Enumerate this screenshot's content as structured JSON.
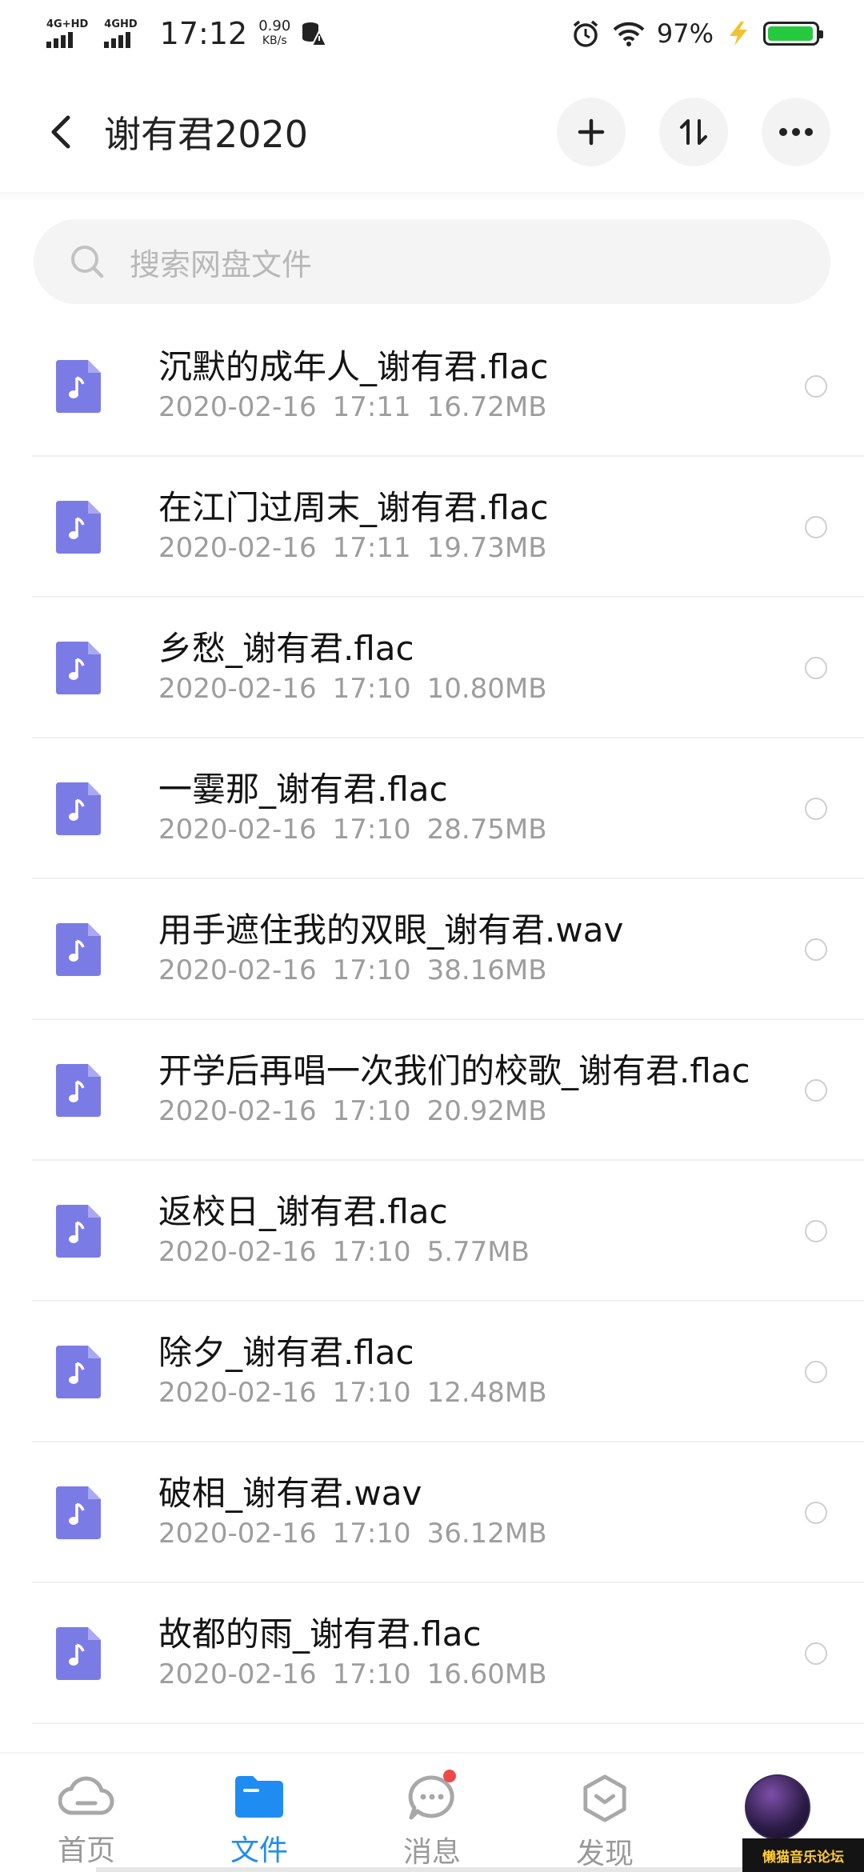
{
  "status_bar": {
    "network1": "4G+HD",
    "network2": "4GHD",
    "time": "17:12",
    "speed_value": "0.90",
    "speed_unit": "KB/s",
    "battery_percent": "97%",
    "battery_level": 0.97,
    "battery_color": "#27c93f"
  },
  "header": {
    "title": "谢有君2020",
    "icons": [
      "back-icon",
      "add-icon",
      "sort-icon",
      "more-icon"
    ]
  },
  "search": {
    "placeholder": "搜索网盘文件"
  },
  "files": [
    {
      "name": "沉默的成年人_谢有君.flac",
      "date": "2020-02-16",
      "time": "17:11",
      "size": "16.72MB"
    },
    {
      "name": "在江门过周末_谢有君.flac",
      "date": "2020-02-16",
      "time": "17:11",
      "size": "19.73MB"
    },
    {
      "name": "乡愁_谢有君.flac",
      "date": "2020-02-16",
      "time": "17:10",
      "size": "10.80MB"
    },
    {
      "name": "一霎那_谢有君.flac",
      "date": "2020-02-16",
      "time": "17:10",
      "size": "28.75MB"
    },
    {
      "name": "用手遮住我的双眼_谢有君.wav",
      "date": "2020-02-16",
      "time": "17:10",
      "size": "38.16MB"
    },
    {
      "name": "开学后再唱一次我们的校歌_谢有君.flac",
      "date": "2020-02-16",
      "time": "17:10",
      "size": "20.92MB"
    },
    {
      "name": "返校日_谢有君.flac",
      "date": "2020-02-16",
      "time": "17:10",
      "size": "5.77MB"
    },
    {
      "name": "除夕_谢有君.flac",
      "date": "2020-02-16",
      "time": "17:10",
      "size": "12.48MB"
    },
    {
      "name": "破相_谢有君.wav",
      "date": "2020-02-16",
      "time": "17:10",
      "size": "36.12MB"
    },
    {
      "name": "故都的雨_谢有君.flac",
      "date": "2020-02-16",
      "time": "17:10",
      "size": "16.60MB"
    }
  ],
  "nav": {
    "home": "首页",
    "files": "文件",
    "messages": "消息",
    "discover": "发现"
  },
  "watermark": "懒猫音乐论坛",
  "colors": {
    "accent": "#1f8cf2",
    "file_icon": "#7b7be6",
    "badge": "#f04848"
  }
}
